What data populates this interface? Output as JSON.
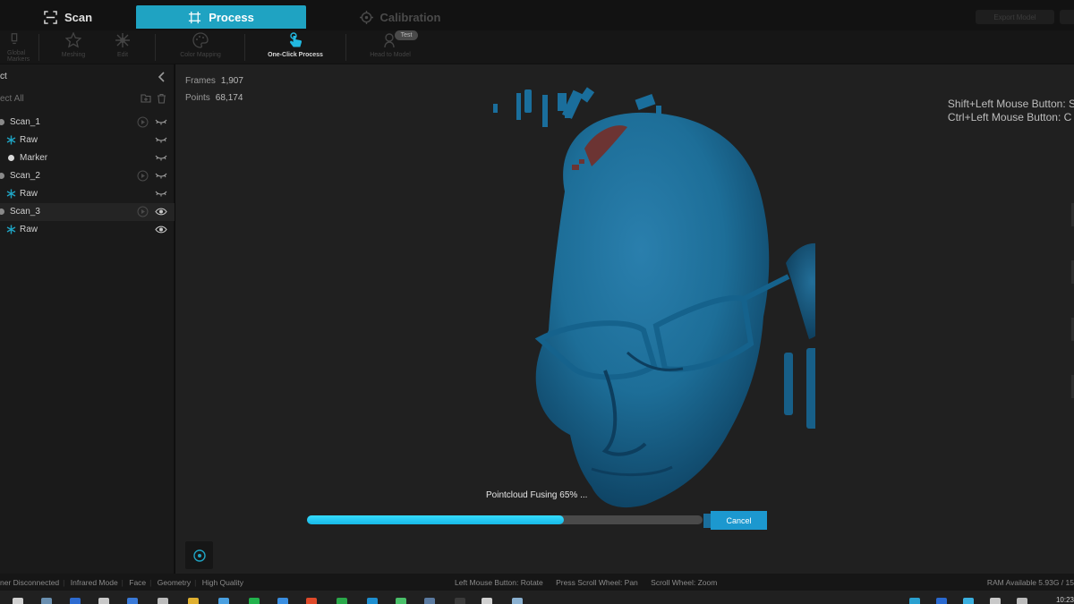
{
  "tabs": {
    "scan": "Scan",
    "process": "Process",
    "calibration": "Calibration"
  },
  "header_right": {
    "export_label": "Export Model"
  },
  "toolbar": {
    "items": [
      {
        "label": "Global Markers",
        "icon": "lightbulb-icon"
      },
      {
        "label": "Meshing",
        "icon": "star-mesh-icon"
      },
      {
        "label": "Edit",
        "icon": "edit-sparkle-icon"
      },
      {
        "label": "Color Mapping",
        "icon": "palette-icon"
      },
      {
        "label": "One-Click Process",
        "icon": "touch-icon"
      },
      {
        "label": "Head to Model",
        "icon": "head-model-icon"
      }
    ],
    "test_badge": "Test"
  },
  "sidebar": {
    "title": "ct",
    "select_all": "ect All",
    "tree": [
      {
        "label": "Scan_1",
        "icon": "scan-icon",
        "play_icon": true,
        "visibility": "eye-hidden-icon",
        "level": 0
      },
      {
        "label": "Raw",
        "icon": "asterisk-icon",
        "visibility": "eye-hidden-icon",
        "level": 1
      },
      {
        "label": "Marker",
        "icon": "marker-dot-icon",
        "visibility": "eye-hidden-icon",
        "level": 1
      },
      {
        "label": "Scan_2",
        "icon": "scan-icon",
        "play_icon": true,
        "visibility": "eye-hidden-icon",
        "level": 0
      },
      {
        "label": "Raw",
        "icon": "asterisk-icon",
        "visibility": "eye-hidden-icon",
        "level": 1
      },
      {
        "label": "Scan_3",
        "icon": "scan-icon",
        "play_icon": true,
        "visibility": "eye-visible-icon",
        "level": 0,
        "selected": true
      },
      {
        "label": "Raw",
        "icon": "asterisk-icon",
        "visibility": "eye-visible-icon",
        "level": 1
      }
    ]
  },
  "viewport": {
    "frames_label": "Frames",
    "frames_value": "1,907",
    "points_label": "Points",
    "points_value": "68,174",
    "hint_1": "Shift+Left Mouse Button: S",
    "hint_2": "Ctrl+Left Mouse Button: C",
    "progress_text": "Pointcloud Fusing 65% ...",
    "progress_fraction": 0.65,
    "cancel_label": "Cancel",
    "model_color": "#1d6e98",
    "accent_color": "#1fa3c2"
  },
  "statusbar": {
    "left": [
      "ner Disconnected",
      "Infrared Mode",
      "Face",
      "Geometry",
      "High Quality"
    ],
    "center": [
      "Left Mouse Button: Rotate",
      "Press Scroll Wheel: Pan",
      "Scroll Wheel: Zoom"
    ],
    "right": "RAM Available 5.93G / 15"
  },
  "taskbar": {
    "clock": "10:23"
  }
}
